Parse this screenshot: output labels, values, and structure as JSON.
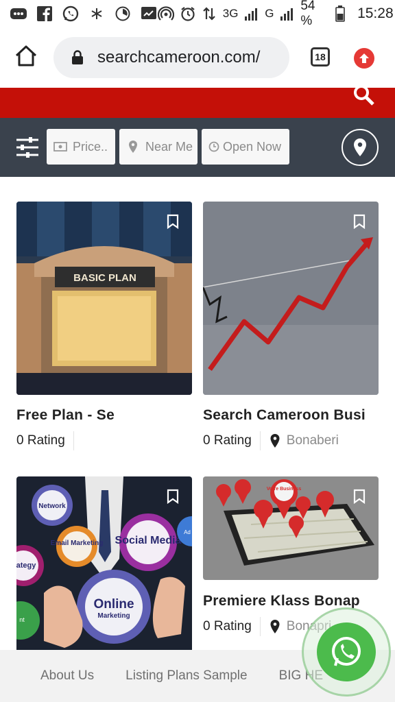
{
  "status_bar": {
    "network_3g": "3G",
    "network_g": "G",
    "battery_percent": "54 %",
    "time": "15:28",
    "icons": [
      "message-icon",
      "facebook-icon",
      "whatsapp-icon",
      "snowflake-icon",
      "timer-icon",
      "chart-icon",
      "hotspot-icon",
      "alarm-icon",
      "data-arrows-icon",
      "signal-icon",
      "battery-icon"
    ]
  },
  "browser": {
    "url": "searchcameroon.com/",
    "tab_count": "18"
  },
  "filters": {
    "price": "Price..",
    "near_me": "Near Me",
    "open_now": "Open Now"
  },
  "listings": [
    {
      "title": "Free Plan - Se",
      "rating": "0 Rating",
      "location": "",
      "image_text": "BASIC PLAN"
    },
    {
      "title": "Search Cameroon Busi",
      "rating": "0 Rating",
      "location": "Bonaberi",
      "image_text": ""
    },
    {
      "title": "",
      "rating": "",
      "location": "",
      "image_labels": [
        "Network",
        "Email Marketing",
        "Social Media",
        "ategy",
        "Online",
        "Marketing",
        "Ad",
        "nt"
      ]
    },
    {
      "title": "Premiere Klass Bonap",
      "rating": "0 Rating",
      "location": "Bonapri",
      "image_labels": [
        "Votre Business"
      ]
    }
  ],
  "footer": {
    "links": [
      "About Us",
      "Listing Plans Sample",
      "BIG HE"
    ]
  },
  "colors": {
    "accent_red": "#c41008",
    "filter_bar": "#3a424d",
    "whatsapp_green": "#4cbb4c"
  }
}
